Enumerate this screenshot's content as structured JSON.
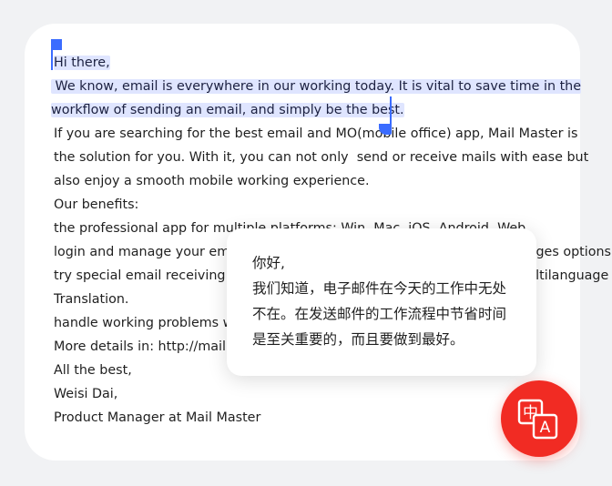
{
  "email": {
    "lines": [
      "Hi there,",
      " We know, email is everywhere in our working today. It is vital to save time in the",
      "workflow of sending an email, and simply be the best.",
      "If you are searching for the best email and MO(mobile office) app, Mail Master is",
      "the solution for you. With it, you can not only  send or receive mails with ease but",
      "also enjoy a smooth mobile working experience.",
      "Our benefits:",
      "the professional app for multiple platforms: Win, Mac, iOS, Android, Web",
      "login and manage your email accounts in a unified inbox with 20+ languages options.",
      "try special email receiving or sending features such as Mail Recall and Multilanguage",
      "Translation.",
      "handle working problems with teamwork collaboration tools",
      "More details in: http://mail.163.com",
      "All the best,",
      "Weisi Dai,",
      "Product Manager at Mail Master"
    ]
  },
  "translation_popup": {
    "lines": [
      "你好,",
      "我们知道，电子邮件在今天的工作中无处",
      "不在。在发送邮件的工作流程中节省时间",
      "是至关重要的，而且要做到最好。"
    ]
  },
  "translate_button": {
    "icon": "translate-icon",
    "glyph_source": "中",
    "glyph_target": "A"
  },
  "colors": {
    "selection": "#dfe5ff",
    "handle": "#3b6cff",
    "accent": "#f12b23"
  }
}
